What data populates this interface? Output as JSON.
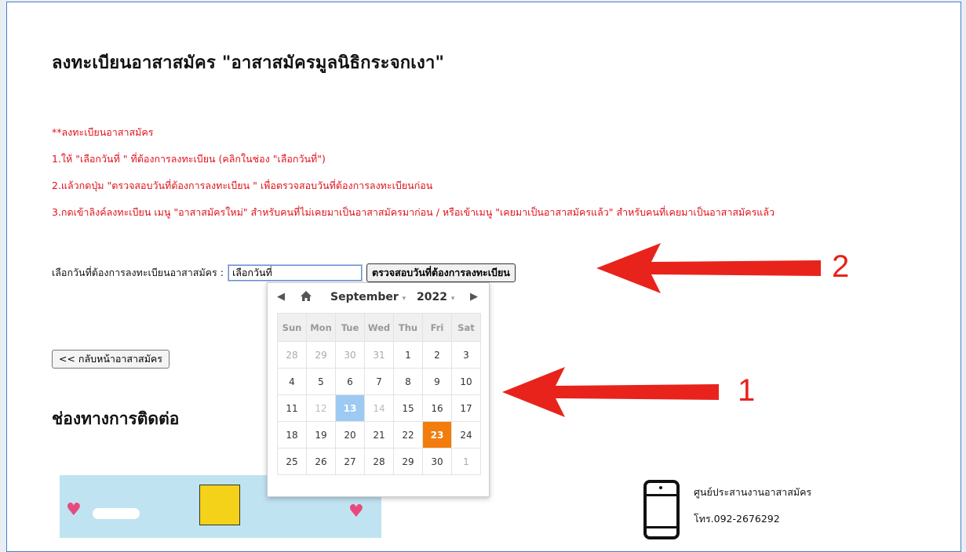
{
  "page": {
    "title": "ลงทะเบียนอาสาสมัคร \"อาสาสมัครมูลนิธิกระจกเงา\"",
    "notes": [
      "**ลงทะเบียนอาสาสมัคร",
      "1.ให้ \"เลือกวันที่ \" ที่ต้องการลงทะเบียน (คลิกในช่อง \"เลือกวันที่\")",
      "2.แล้วกดปุ่ม \"ตรวจสอบวันที่ต้องการลงทะเบียน \" เพื่อตรวจสอบวันที่ต้องการลงทะเบียนก่อน",
      "3.กดเข้าลิงค์ลงทะเบียน เมนู \"อาสาสมัครใหม่\" สำหรับคนที่ไม่เคยมาเป็นอาสาสมัครมาก่อน / หรือเข้าเมนู \"เคยมาเป็นอาสาสมัครแล้ว\" สำหรับคนที่เคยมาเป็นอาสาสมัครแล้ว"
    ],
    "date_label": "เลือกวันที่ต้องการลงทะเบียนอาสาสมัคร :",
    "date_input_value": "เลือกวันที่",
    "check_button": "ตรวจสอบวันที่ต้องการลงทะเบียน",
    "back_button": "<< กลับหน้าอาสาสมัคร",
    "contact_heading": "ช่องทางการติดต่อ",
    "contact_name": "ศูนย์ประสานงานอาสาสมัคร",
    "contact_phone": "โทร.092-2676292"
  },
  "calendar": {
    "month": "September",
    "year": "2022",
    "weekdays": [
      "Sun",
      "Mon",
      "Tue",
      "Wed",
      "Thu",
      "Fri",
      "Sat"
    ],
    "weeks": [
      [
        [
          "28",
          "other"
        ],
        [
          "29",
          "other"
        ],
        [
          "30",
          "other"
        ],
        [
          "31",
          "other"
        ],
        [
          "1",
          ""
        ],
        [
          "2",
          ""
        ],
        [
          "3",
          ""
        ]
      ],
      [
        [
          "4",
          ""
        ],
        [
          "5",
          ""
        ],
        [
          "6",
          ""
        ],
        [
          "7",
          ""
        ],
        [
          "8",
          ""
        ],
        [
          "9",
          ""
        ],
        [
          "10",
          ""
        ]
      ],
      [
        [
          "11",
          ""
        ],
        [
          "12",
          "dis"
        ],
        [
          "13",
          "today"
        ],
        [
          "14",
          "dis"
        ],
        [
          "15",
          ""
        ],
        [
          "16",
          ""
        ],
        [
          "17",
          ""
        ]
      ],
      [
        [
          "18",
          ""
        ],
        [
          "19",
          ""
        ],
        [
          "20",
          ""
        ],
        [
          "21",
          ""
        ],
        [
          "22",
          ""
        ],
        [
          "23",
          "sel"
        ],
        [
          "24",
          ""
        ]
      ],
      [
        [
          "25",
          ""
        ],
        [
          "26",
          ""
        ],
        [
          "27",
          ""
        ],
        [
          "28",
          ""
        ],
        [
          "29",
          ""
        ],
        [
          "30",
          ""
        ],
        [
          "1",
          "other"
        ]
      ]
    ]
  },
  "annotations": {
    "label_1": "1",
    "label_2": "2",
    "color": "#e8231c"
  },
  "icons": {
    "prev": "chevron-left-icon",
    "home": "home-icon",
    "next": "chevron-right-icon"
  }
}
